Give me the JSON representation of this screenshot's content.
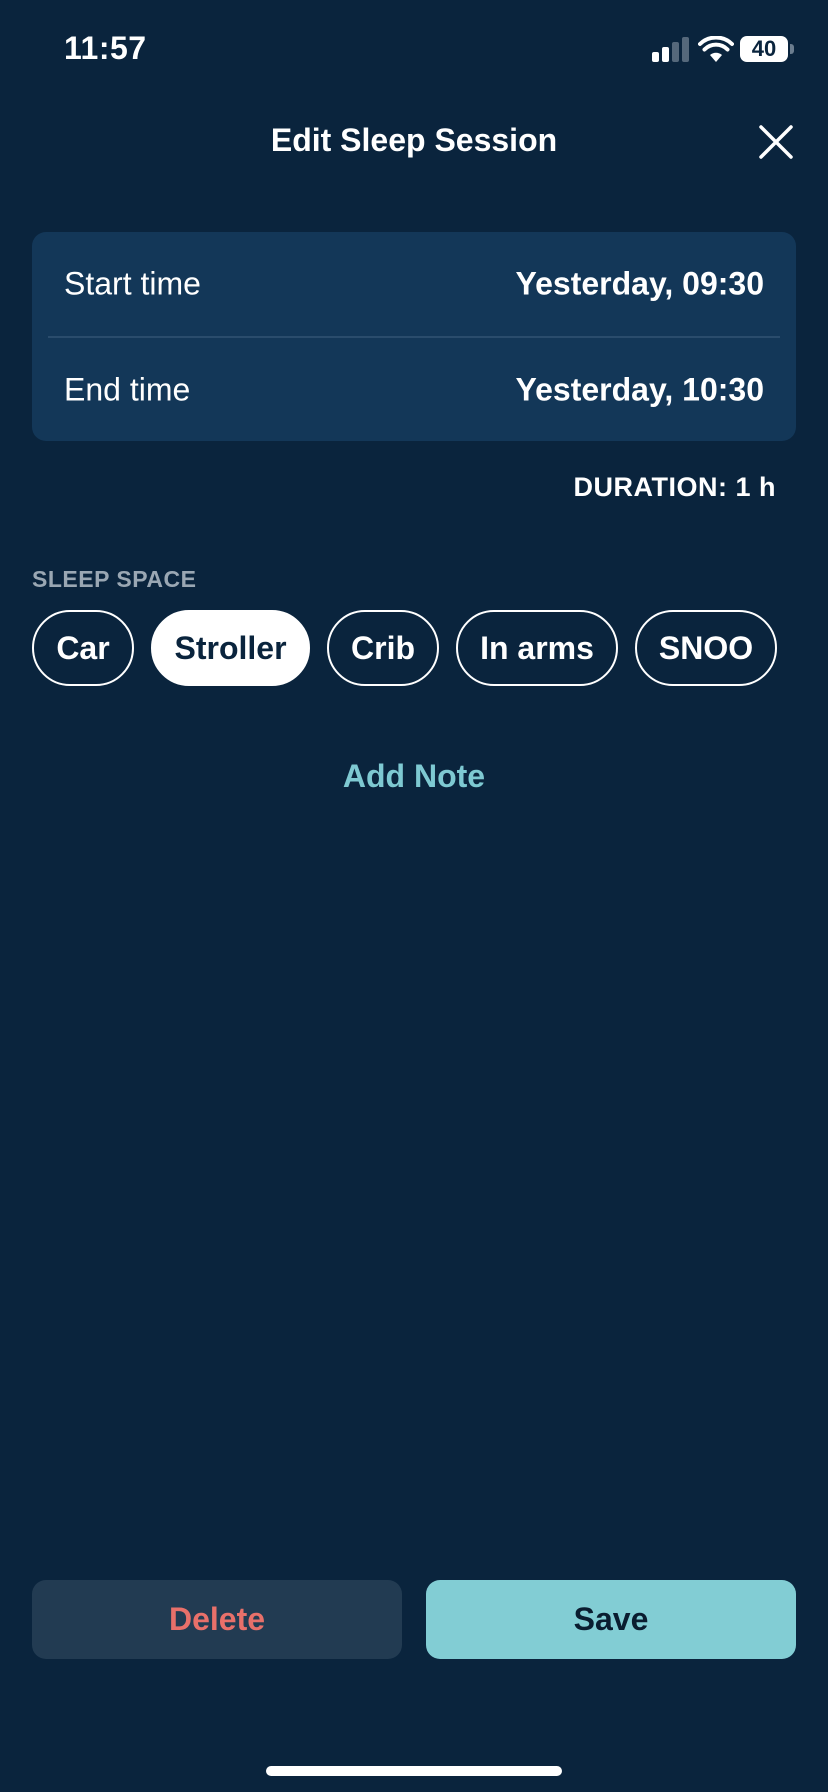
{
  "status_bar": {
    "time": "11:57",
    "battery_level": "40",
    "icons": [
      "cellular-signal-icon",
      "wifi-icon",
      "battery-icon"
    ]
  },
  "header": {
    "title": "Edit Sleep Session",
    "close_icon": "close-icon"
  },
  "times": {
    "start_label": "Start time",
    "start_value": "Yesterday, 09:30",
    "end_label": "End time",
    "end_value": "Yesterday, 10:30"
  },
  "duration": "DURATION: 1 h",
  "sleep_space": {
    "label": "SLEEP SPACE",
    "options": [
      "Car",
      "Stroller",
      "Crib",
      "In arms",
      "SNOO"
    ],
    "selected": "Stroller"
  },
  "add_note_label": "Add Note",
  "actions": {
    "delete_label": "Delete",
    "save_label": "Save"
  },
  "colors": {
    "background": "#0a243d",
    "card": "#133758",
    "accent": "#82cdd4",
    "delete_text": "#e8706a"
  }
}
